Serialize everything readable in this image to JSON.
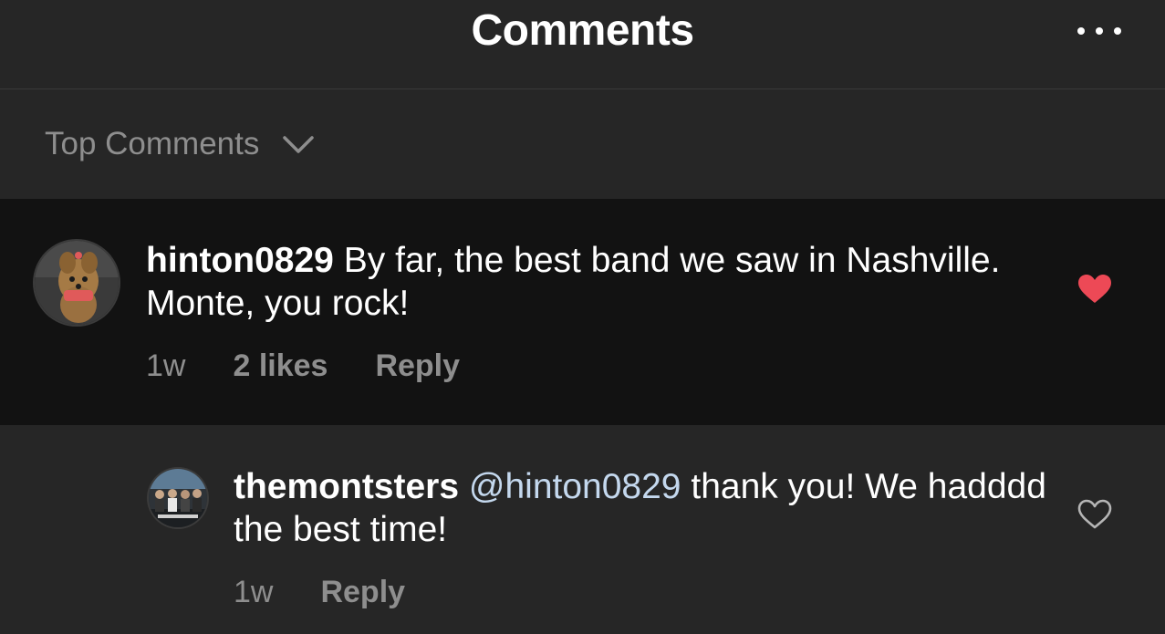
{
  "header": {
    "title": "Comments",
    "more_icon": "more-horizontal-icon"
  },
  "sort": {
    "label": "Top Comments",
    "icon": "chevron-down-icon"
  },
  "comments": [
    {
      "username": "hinton0829",
      "text": "By far, the best band we saw in Nashville. Monte, you rock!",
      "time": "1w",
      "likes": "2 likes",
      "reply": "Reply",
      "liked": true,
      "heart_color": "#ed4956"
    },
    {
      "username": "themontsters",
      "mention": "@hinton0829",
      "text": "thank you! We hadddd the best time!",
      "time": "1w",
      "reply": "Reply",
      "liked": false
    }
  ],
  "colors": {
    "background": "#262626",
    "highlight_row": "#121212",
    "secondary_text": "#8e8e8e",
    "mention": "#c4d8ee"
  }
}
